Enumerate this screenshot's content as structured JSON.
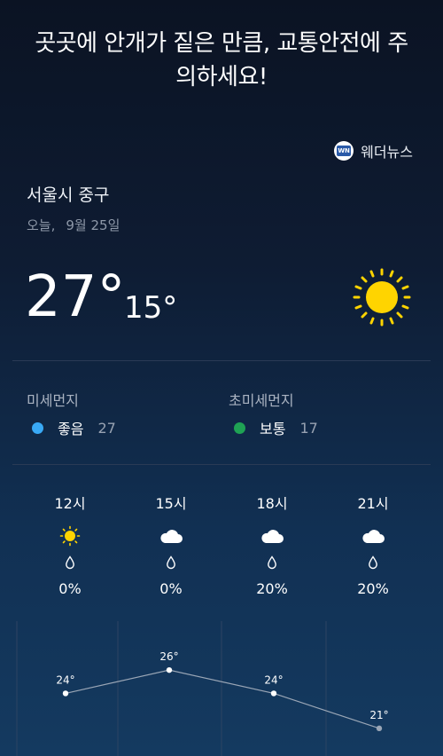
{
  "headline": "곳곳에 안개가 짙은 만큼, 교통안전에 주의하세요!",
  "provider": {
    "logo_text": "WN",
    "name": "웨더뉴스"
  },
  "location": "서울시 중구",
  "date": {
    "day": "오늘,",
    "date": "9월 25일"
  },
  "current": {
    "temp": "27°",
    "low": "15°",
    "icon": "sun-icon"
  },
  "air": [
    {
      "label": "미세먼지",
      "status": "좋음",
      "value": "27",
      "color": "#39a9f5"
    },
    {
      "label": "초미세먼지",
      "status": "보통",
      "value": "17",
      "color": "#1fa254"
    }
  ],
  "hourly": [
    {
      "time": "12시",
      "icon": "sun-icon",
      "precip": "0%",
      "temp": 24,
      "temp_label": "24°"
    },
    {
      "time": "15시",
      "icon": "cloud-icon",
      "precip": "0%",
      "temp": 26,
      "temp_label": "26°"
    },
    {
      "time": "18시",
      "icon": "cloud-icon",
      "precip": "20%",
      "temp": 24,
      "temp_label": "24°"
    },
    {
      "time": "21시",
      "icon": "cloud-icon",
      "precip": "20%",
      "temp": 21,
      "temp_label": "21°"
    }
  ],
  "colors": {
    "sun": "#ffd400",
    "line": "#9aa6b6"
  }
}
